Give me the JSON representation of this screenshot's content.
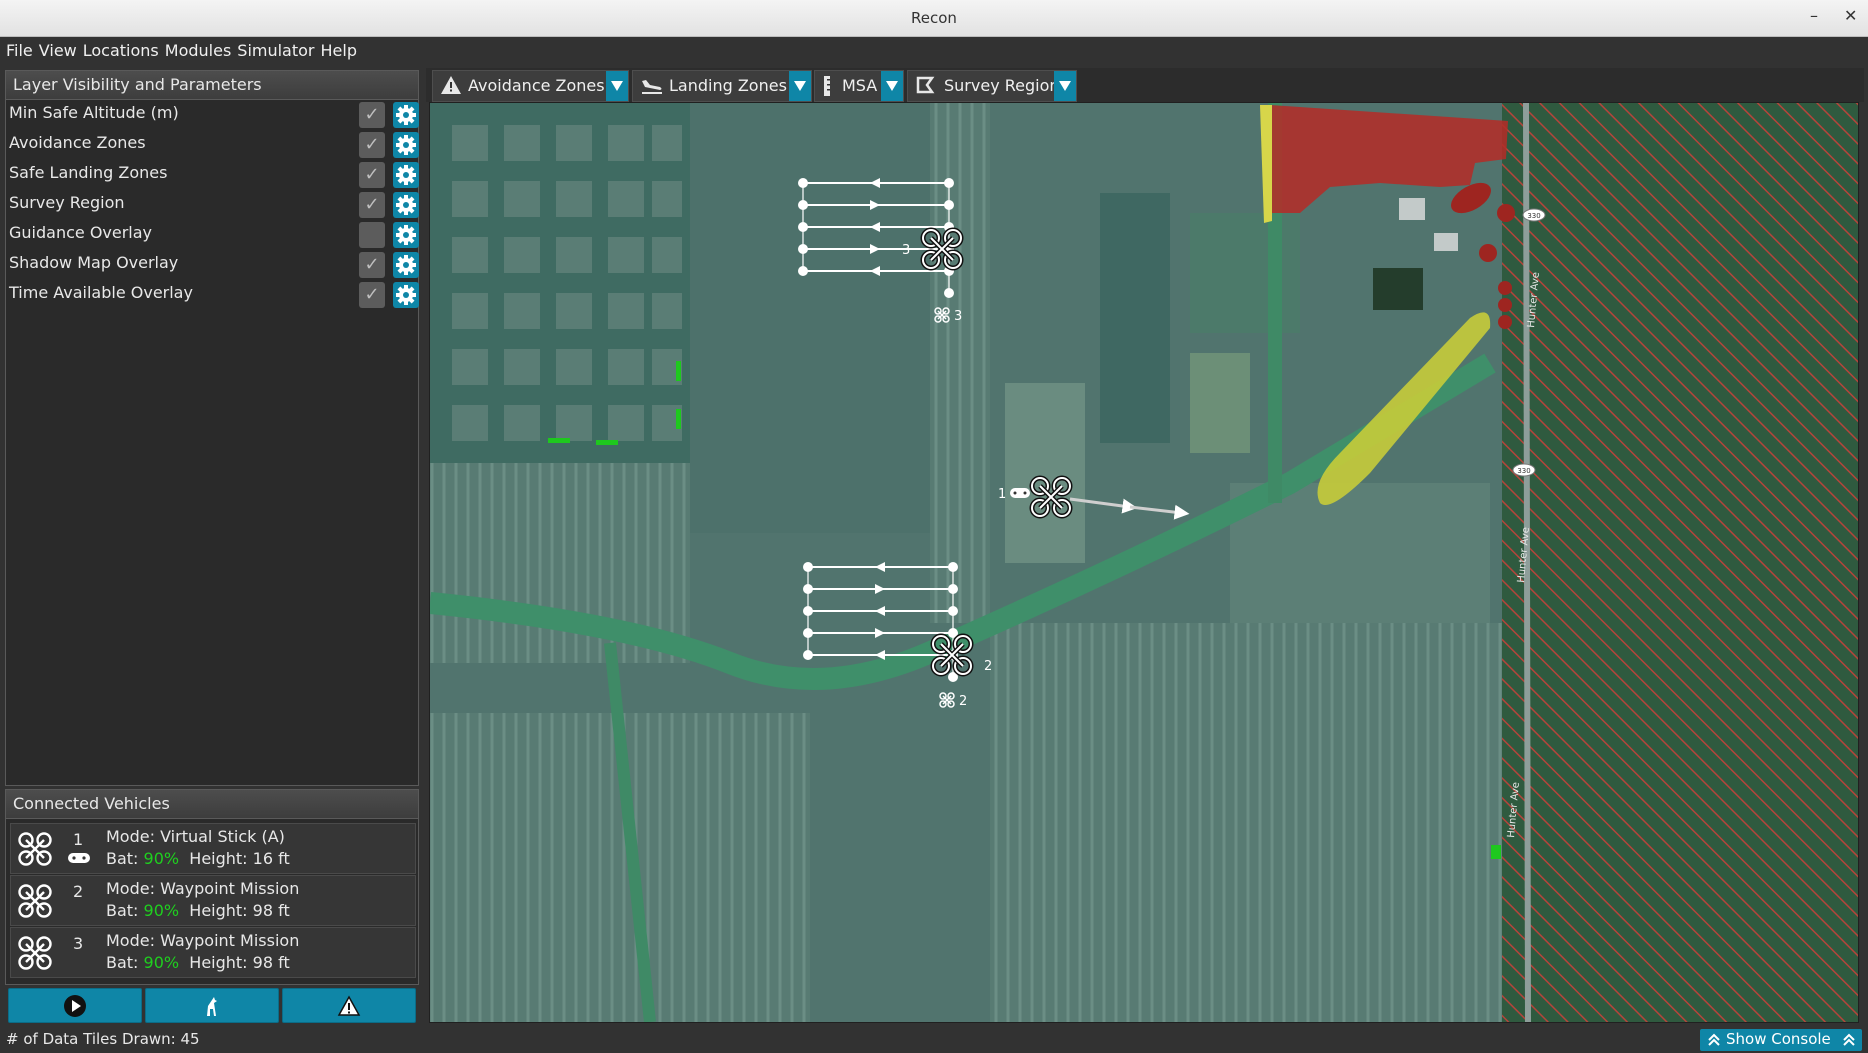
{
  "window": {
    "title": "Recon",
    "minimize": "–",
    "close": "✕"
  },
  "menu": [
    "File",
    "View",
    "Locations",
    "Modules",
    "Simulator",
    "Help"
  ],
  "layers_panel": {
    "title": "Layer Visibility and Parameters",
    "layers": [
      {
        "label": "Min Safe Altitude (m)",
        "checked": true
      },
      {
        "label": "Avoidance Zones",
        "checked": true
      },
      {
        "label": "Safe Landing Zones",
        "checked": true
      },
      {
        "label": "Survey Region",
        "checked": true
      },
      {
        "label": "Guidance Overlay",
        "checked": false
      },
      {
        "label": "Shadow Map Overlay",
        "checked": true
      },
      {
        "label": "Time Available Overlay",
        "checked": true
      }
    ]
  },
  "vehicles_panel": {
    "title": "Connected Vehicles",
    "vehicles": [
      {
        "id": "1",
        "mode": "Mode: Virtual Stick (A)",
        "bat_label": "Bat:",
        "bat": "90%",
        "height": "Height: 16 ft"
      },
      {
        "id": "2",
        "mode": "Mode: Waypoint Mission",
        "bat_label": "Bat:",
        "bat": "90%",
        "height": "Height: 98 ft"
      },
      {
        "id": "3",
        "mode": "Mode: Waypoint Mission",
        "bat_label": "Bat:",
        "bat": "90%",
        "height": "Height: 98 ft"
      }
    ],
    "actions": [
      "play-icon",
      "dog-icon",
      "warning-icon"
    ]
  },
  "toolbar": {
    "avoidance": "Avoidance Zones",
    "landing": "Landing Zones",
    "msa": "MSA",
    "survey": "Survey Region"
  },
  "map": {
    "drone_labels": {
      "d1": "1",
      "d2": "2",
      "d3": "3",
      "m2": "2",
      "m3": "3"
    },
    "road_labels": {
      "road": "Hunter Ave",
      "shield": "330"
    }
  },
  "status": {
    "tiles": "# of Data Tiles Drawn: 45",
    "console": "Show Console"
  },
  "colors": {
    "accent": "#0f86a7",
    "battery": "#1fcf1f",
    "avoid": "#b52c27",
    "landing": "#c6cc3a"
  }
}
